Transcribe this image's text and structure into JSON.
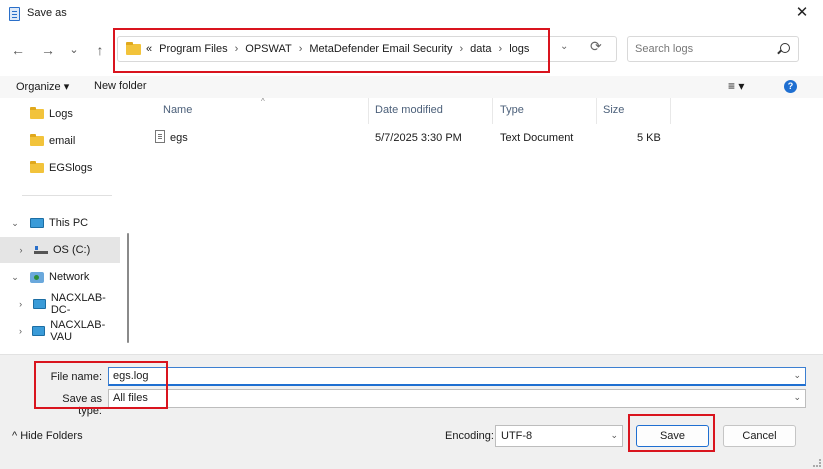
{
  "window": {
    "title": "Save as",
    "close_label": "✕"
  },
  "nav": {
    "back": "←",
    "forward": "→",
    "recent": "⌄",
    "up": "↑"
  },
  "address": {
    "overflow": "«",
    "crumbs": [
      "Program Files",
      "OPSWAT",
      "MetaDefender Email Security",
      "data",
      "logs"
    ],
    "separator": "›",
    "dropdown": "⌄",
    "refresh": "⟳"
  },
  "search": {
    "placeholder": "Search logs"
  },
  "toolbar": {
    "organize": "Organize ▾",
    "new_folder": "New folder",
    "view": "≡ ▾",
    "help": "?"
  },
  "sidebar": {
    "quick_items": [
      {
        "label": "Logs",
        "icon": "folder-icon"
      },
      {
        "label": "email",
        "icon": "folder-icon"
      },
      {
        "label": "EGSlogs",
        "icon": "folder-icon"
      }
    ],
    "this_pc": "This PC",
    "os_drive": "OS (C:)",
    "network": "Network",
    "network_items": [
      "NACXLAB-DC-",
      "NACXLAB-VAU"
    ],
    "chevron_down": "⌄",
    "chevron_right": "›"
  },
  "columns": {
    "name": "Name",
    "date": "Date modified",
    "type": "Type",
    "size": "Size",
    "sort_indicator": "^"
  },
  "files": [
    {
      "name": "egs",
      "date": "5/7/2025 3:30 PM",
      "type": "Text Document",
      "size": "5 KB"
    }
  ],
  "form": {
    "filename_label": "File name:",
    "filename_value": "egs.log",
    "savetype_label": "Save as type:",
    "savetype_value": "All files",
    "hide_folders": "^ Hide Folders",
    "encoding_label": "Encoding:",
    "encoding_value": "UTF-8",
    "save": "Save",
    "cancel": "Cancel"
  },
  "colors": {
    "highlight": "#d9141e",
    "accent": "#1f6fd1"
  }
}
